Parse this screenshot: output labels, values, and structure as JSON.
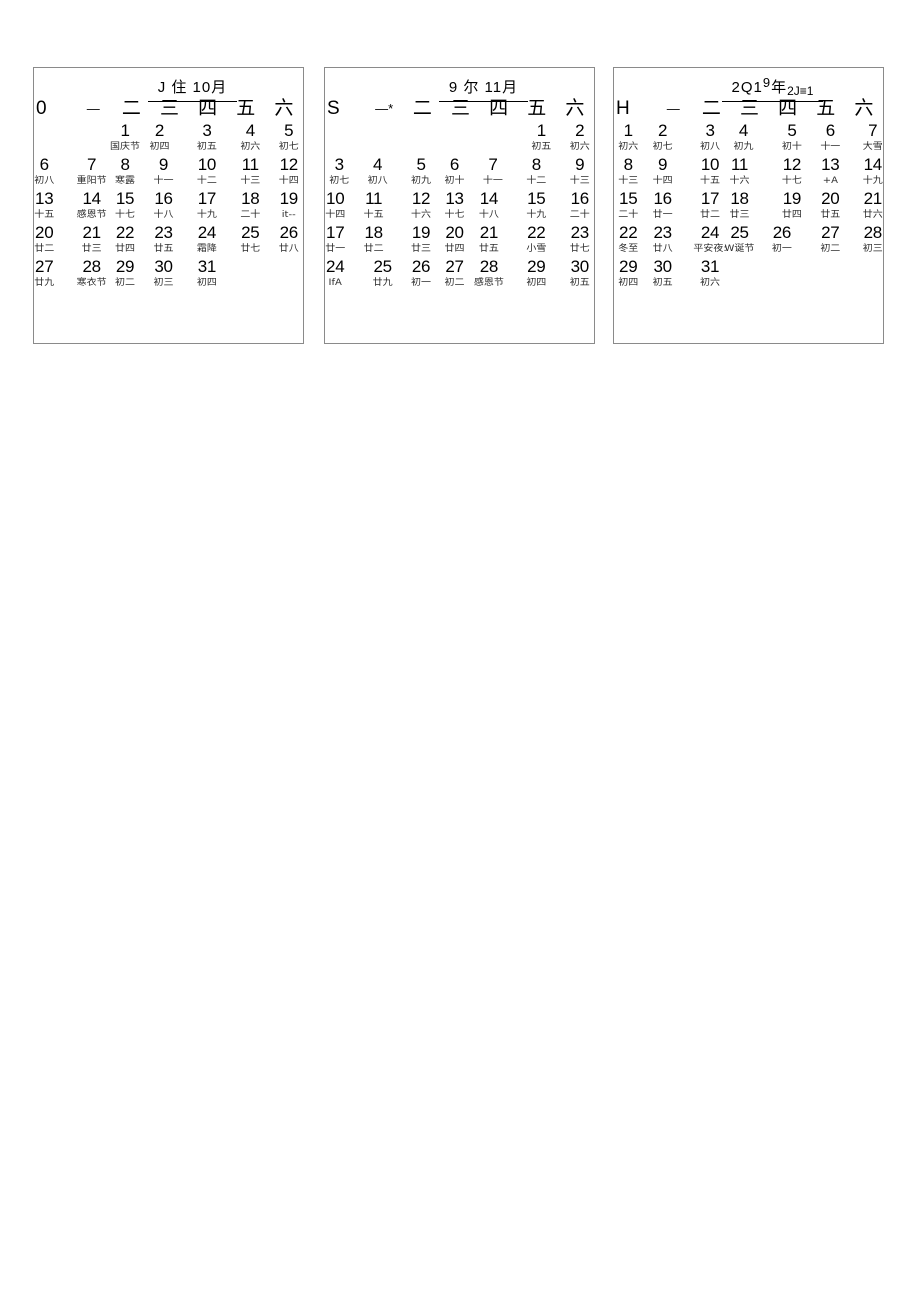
{
  "page": {
    "background_color": "#ffffff",
    "text_color": "#000000",
    "border_color": "#8a8a8a"
  },
  "months": [
    {
      "id": "october",
      "title_main": "J 住 10",
      "title_sup": "",
      "title_tail": "月",
      "title_sub": "",
      "weekday_headers": [
        "0",
        "—",
        "二",
        "三",
        "四",
        "五",
        "六"
      ],
      "weeks": [
        [
          {
            "day": "",
            "lunar": ""
          },
          {
            "day": "",
            "lunar": ""
          },
          {
            "day": "1",
            "lunar": "国庆节"
          },
          {
            "day": "2",
            "lunar": "初四"
          },
          {
            "day": "3",
            "lunar": "初五"
          },
          {
            "day": "4",
            "lunar": "初六"
          },
          {
            "day": "5",
            "lunar": "初七"
          }
        ],
        [
          {
            "day": "6",
            "lunar": "初八"
          },
          {
            "day": "7",
            "lunar": "重阳节"
          },
          {
            "day": "8",
            "lunar": "寒露"
          },
          {
            "day": "9",
            "lunar": "十一"
          },
          {
            "day": "10",
            "lunar": "十二"
          },
          {
            "day": "11",
            "lunar": "十三"
          },
          {
            "day": "12",
            "lunar": "十四"
          }
        ],
        [
          {
            "day": "13",
            "lunar": "十五"
          },
          {
            "day": "14",
            "lunar": "感恩节"
          },
          {
            "day": "15",
            "lunar": "十七"
          },
          {
            "day": "16",
            "lunar": "十八"
          },
          {
            "day": "17",
            "lunar": "十九"
          },
          {
            "day": "18",
            "lunar": "二十"
          },
          {
            "day": "19",
            "lunar": "it--"
          }
        ],
        [
          {
            "day": "20",
            "lunar": "廿二"
          },
          {
            "day": "21",
            "lunar": "廿三"
          },
          {
            "day": "22",
            "lunar": "廿四"
          },
          {
            "day": "23",
            "lunar": "廿五"
          },
          {
            "day": "24",
            "lunar": "霜降"
          },
          {
            "day": "25",
            "lunar": "廿七"
          },
          {
            "day": "26",
            "lunar": "廿八"
          }
        ],
        [
          {
            "day": "27",
            "lunar": "廿九"
          },
          {
            "day": "28",
            "lunar": "寒衣节"
          },
          {
            "day": "29",
            "lunar": "初二"
          },
          {
            "day": "30",
            "lunar": "初三"
          },
          {
            "day": "31",
            "lunar": "初四"
          },
          {
            "day": "",
            "lunar": ""
          },
          {
            "day": "",
            "lunar": ""
          }
        ]
      ]
    },
    {
      "id": "november",
      "title_main": "9 尔 11",
      "title_sup": "",
      "title_tail": "月",
      "title_sub": "",
      "weekday_headers": [
        "S",
        "—*",
        "二",
        "三",
        "四",
        "五",
        "六"
      ],
      "weeks": [
        [
          {
            "day": "",
            "lunar": ""
          },
          {
            "day": "",
            "lunar": ""
          },
          {
            "day": "",
            "lunar": ""
          },
          {
            "day": "",
            "lunar": ""
          },
          {
            "day": "",
            "lunar": ""
          },
          {
            "day": "1",
            "lunar": "初五"
          },
          {
            "day": "2",
            "lunar": "初六"
          }
        ],
        [
          {
            "day": "3",
            "lunar": "初七"
          },
          {
            "day": "4",
            "lunar": "初八"
          },
          {
            "day": "5",
            "lunar": "初九"
          },
          {
            "day": "6",
            "lunar": "初十"
          },
          {
            "day": "7",
            "lunar": "十一"
          },
          {
            "day": "8",
            "lunar": "十二"
          },
          {
            "day": "9",
            "lunar": "十三"
          }
        ],
        [
          {
            "day": "10",
            "lunar": "十四"
          },
          {
            "day": "11",
            "lunar": "十五"
          },
          {
            "day": "12",
            "lunar": "十六"
          },
          {
            "day": "13",
            "lunar": "十七"
          },
          {
            "day": "14",
            "lunar": "十八"
          },
          {
            "day": "15",
            "lunar": "十九"
          },
          {
            "day": "16",
            "lunar": "二十"
          }
        ],
        [
          {
            "day": "17",
            "lunar": "廿一"
          },
          {
            "day": "18",
            "lunar": "廿二"
          },
          {
            "day": "19",
            "lunar": "廿三"
          },
          {
            "day": "20",
            "lunar": "廿四"
          },
          {
            "day": "21",
            "lunar": "廿五"
          },
          {
            "day": "22",
            "lunar": "小雪"
          },
          {
            "day": "23",
            "lunar": "廿七"
          }
        ],
        [
          {
            "day": "24",
            "lunar": "IfA"
          },
          {
            "day": "25",
            "lunar": "廿九"
          },
          {
            "day": "26",
            "lunar": "初一"
          },
          {
            "day": "27",
            "lunar": "初二"
          },
          {
            "day": "28",
            "lunar": "感恩节"
          },
          {
            "day": "29",
            "lunar": "初四"
          },
          {
            "day": "30",
            "lunar": "初五"
          }
        ]
      ]
    },
    {
      "id": "december",
      "title_main": "2Q1",
      "title_sup": "9",
      "title_tail": "年",
      "title_sub": "2J≡1",
      "weekday_headers": [
        "H",
        "—",
        "二",
        "三",
        "四",
        "五",
        "六"
      ],
      "weeks": [
        [
          {
            "day": "1",
            "lunar": "初六"
          },
          {
            "day": "2",
            "lunar": "初七"
          },
          {
            "day": "3",
            "lunar": "初八"
          },
          {
            "day": "4",
            "lunar": "初九"
          },
          {
            "day": "5",
            "lunar": "初十"
          },
          {
            "day": "6",
            "lunar": "十一"
          },
          {
            "day": "7",
            "lunar": "大雪"
          }
        ],
        [
          {
            "day": "8",
            "lunar": "十三"
          },
          {
            "day": "9",
            "lunar": "十四"
          },
          {
            "day": "10",
            "lunar": "十五"
          },
          {
            "day": "11",
            "lunar": "十六"
          },
          {
            "day": "12",
            "lunar": "十七"
          },
          {
            "day": "13",
            "lunar": "+A"
          },
          {
            "day": "14",
            "lunar": "十九"
          }
        ],
        [
          {
            "day": "15",
            "lunar": "二十"
          },
          {
            "day": "16",
            "lunar": "廿一"
          },
          {
            "day": "17",
            "lunar": "廿二"
          },
          {
            "day": "18",
            "lunar": "廿三"
          },
          {
            "day": "19",
            "lunar": "廿四"
          },
          {
            "day": "20",
            "lunar": "廿五"
          },
          {
            "day": "21",
            "lunar": "廿六"
          }
        ],
        [
          {
            "day": "22",
            "lunar": "冬至"
          },
          {
            "day": "23",
            "lunar": "廿八"
          },
          {
            "day": "24",
            "lunar": "平安夜:"
          },
          {
            "day": "25",
            "lunar": "W诞节"
          },
          {
            "day": "26",
            "lunar": "初一"
          },
          {
            "day": "27",
            "lunar": "初二"
          },
          {
            "day": "28",
            "lunar": "初三"
          }
        ],
        [
          {
            "day": "29",
            "lunar": "初四"
          },
          {
            "day": "30",
            "lunar": "初五"
          },
          {
            "day": "31",
            "lunar": "初六"
          },
          {
            "day": "",
            "lunar": ""
          },
          {
            "day": "",
            "lunar": ""
          },
          {
            "day": "",
            "lunar": ""
          },
          {
            "day": "",
            "lunar": ""
          }
        ]
      ]
    }
  ]
}
